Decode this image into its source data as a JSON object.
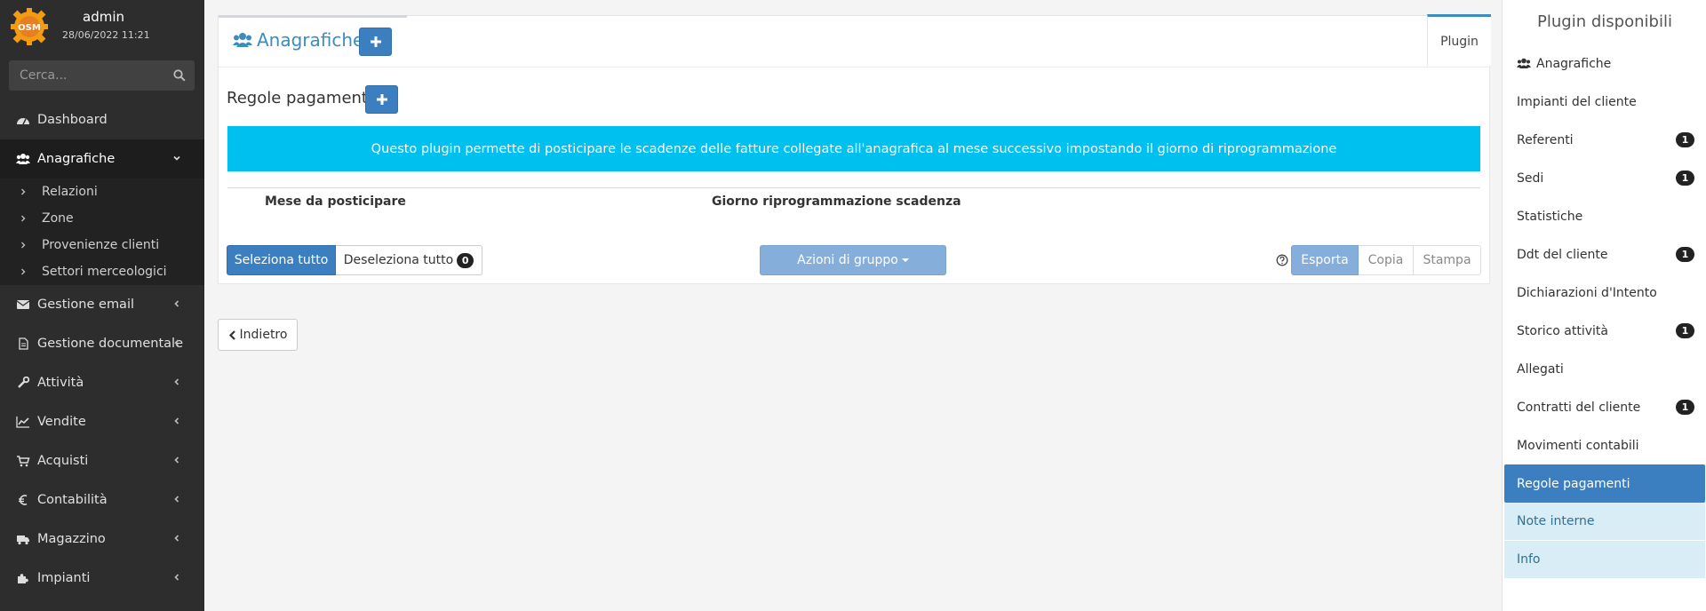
{
  "user": {
    "name": "admin",
    "datetime": "28/06/2022 11:21",
    "logo_text": "OSM"
  },
  "search": {
    "placeholder": "Cerca..."
  },
  "sidebar": {
    "items": [
      {
        "label": "Dashboard"
      },
      {
        "label": "Anagrafiche"
      },
      {
        "label": "Gestione email"
      },
      {
        "label": "Gestione documentale"
      },
      {
        "label": "Attività"
      },
      {
        "label": "Vendite"
      },
      {
        "label": "Acquisti"
      },
      {
        "label": "Contabilità"
      },
      {
        "label": "Magazzino"
      },
      {
        "label": "Impianti"
      }
    ],
    "submenu": [
      {
        "label": "Relazioni"
      },
      {
        "label": "Zone"
      },
      {
        "label": "Provenienze clienti"
      },
      {
        "label": "Settori merceologici"
      }
    ]
  },
  "header": {
    "title": "Anagrafiche",
    "tab_plugin": "Plugin"
  },
  "section": {
    "title": "Regole pagamenti",
    "callout": "Questo plugin permette di posticipare le scadenze delle fatture collegate all'anagrafica al mese successivo impostando il giorno di riprogrammazione",
    "columns": [
      "Mese da posticipare",
      "Giorno riprogrammazione scadenza"
    ]
  },
  "actions": {
    "select_all": "Seleziona tutto",
    "deselect_all": "Deseleziona tutto",
    "deselect_count": "0",
    "group_actions": "Azioni di gruppo",
    "export": "Esporta",
    "copy": "Copia",
    "print": "Stampa"
  },
  "back_button": "Indietro",
  "plugins": {
    "title": "Plugin disponibili",
    "items": [
      {
        "label": "Anagrafiche",
        "badge": ""
      },
      {
        "label": "Impianti del cliente",
        "badge": ""
      },
      {
        "label": "Referenti",
        "badge": "1"
      },
      {
        "label": "Sedi",
        "badge": "1"
      },
      {
        "label": "Statistiche",
        "badge": ""
      },
      {
        "label": "Ddt del cliente",
        "badge": "1"
      },
      {
        "label": "Dichiarazioni d'Intento",
        "badge": ""
      },
      {
        "label": "Storico attività",
        "badge": "1"
      },
      {
        "label": "Allegati",
        "badge": ""
      },
      {
        "label": "Contratti del cliente",
        "badge": "1"
      },
      {
        "label": "Movimenti contabili",
        "badge": ""
      },
      {
        "label": "Regole pagamenti",
        "badge": ""
      },
      {
        "label": "Note interne",
        "badge": ""
      },
      {
        "label": "Info",
        "badge": ""
      }
    ]
  },
  "colors": {
    "primary": "#3c7fc0",
    "callout": "#00c0ef",
    "sidebar": "#2d2d2d",
    "light_info": "#d9edf7"
  }
}
